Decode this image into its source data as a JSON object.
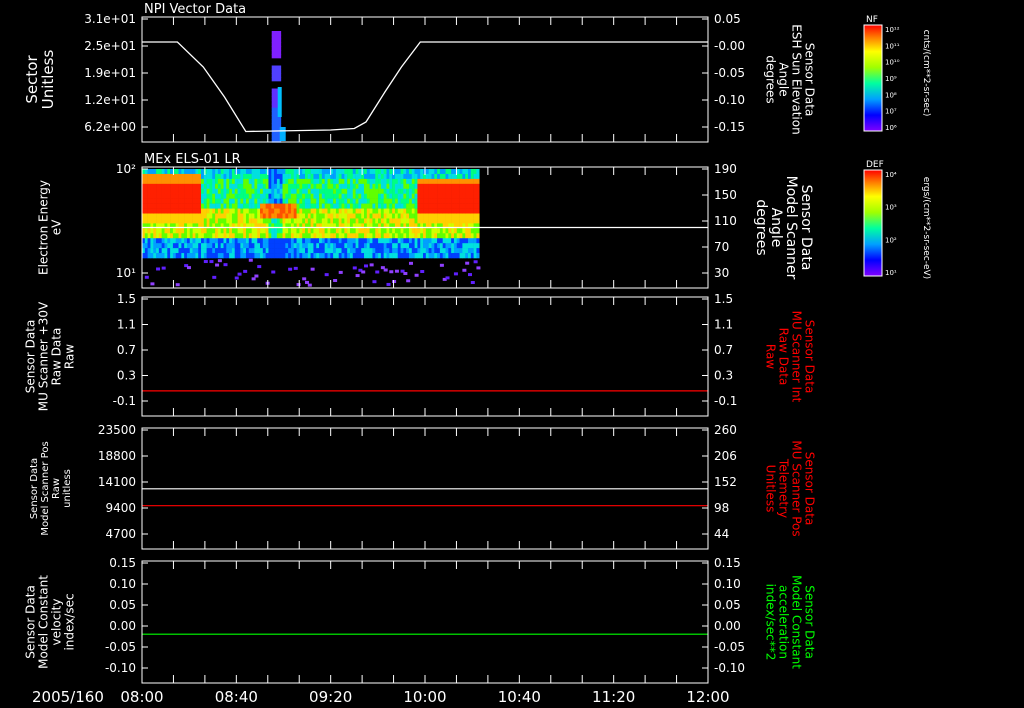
{
  "chart_data": {
    "date_label": "2005/160",
    "time_ticks": [
      "08:00",
      "08:40",
      "09:20",
      "10:00",
      "10:40",
      "11:20",
      "12:00"
    ],
    "time_range_min": [
      480,
      720
    ],
    "panels": [
      {
        "type": "heatmap",
        "title": "NPI Vector Data",
        "ylabel": [
          "Sector",
          "Unitless"
        ],
        "yticks": [
          "3.1e+01",
          "2.5e+01",
          "1.9e+01",
          "1.2e+01",
          "6.2e+00"
        ],
        "ylabel_right": [
          "Sensor Data",
          "ESH Sun Elevation",
          "Angle",
          "degrees"
        ],
        "yticks_right": [
          "0.05",
          "-0.00",
          "-0.05",
          "-0.10",
          "-0.15"
        ],
        "ylim_right": [
          -0.2,
          0.05
        ],
        "colorbar": {
          "label": "NF",
          "unit": "cnts/(cm**2-sr-sec)",
          "ticks": [
            "10¹²",
            "10¹¹",
            "10¹⁰",
            "10⁹",
            "10⁸",
            "10⁷",
            "10⁶"
          ]
        },
        "heatmap_block_min": [
          535,
          539
        ],
        "line_series": {
          "name": "ESH Sun Elevation Angle",
          "color": "#ffffff",
          "points": [
            [
              480,
              0.0
            ],
            [
              495,
              0.0
            ],
            [
              506,
              -0.05
            ],
            [
              515,
              -0.11
            ],
            [
              524,
              -0.179
            ],
            [
              560,
              -0.176
            ],
            [
              570,
              -0.173
            ],
            [
              575,
              -0.16
            ],
            [
              583,
              -0.1
            ],
            [
              590,
              -0.05
            ],
            [
              598,
              0.0
            ],
            [
              720,
              0.0
            ]
          ]
        }
      },
      {
        "type": "heatmap",
        "title": "MEx ELS-01 LR",
        "ylabel": [
          "Electron Energy",
          "eV"
        ],
        "yticks": [
          "10²",
          "10¹"
        ],
        "ylabel_right": [
          "Sensor Data",
          "Model Scanner",
          "Angle",
          "degrees"
        ],
        "yticks_right": [
          "190",
          "150",
          "110",
          "70",
          "30"
        ],
        "ylim_right": [
          10,
          190
        ],
        "colorbar": {
          "label": "DEF",
          "unit": "ergs/(cm**2-sr-sec-eV)",
          "ticks": [
            "10⁴",
            "10³",
            "10²",
            "10¹"
          ]
        },
        "data_end_min": 623,
        "line_series": {
          "name": "Model Scanner Angle",
          "color": "#ffffff",
          "points": [
            [
              480,
              100
            ],
            [
              720,
              100
            ]
          ]
        }
      },
      {
        "type": "line",
        "ylabel": [
          "Sensor Data",
          "MU Scanner +30V",
          "Raw Data",
          "Raw"
        ],
        "yticks": [
          "1.5",
          "1.1",
          "0.7",
          "0.3",
          "-0.1"
        ],
        "ylim": [
          -0.4,
          1.5
        ],
        "ylabel_right": [
          "Sensor Data",
          "MU Scanner Int",
          "Raw Data",
          "Raw"
        ],
        "yticks_right": [
          "1.5",
          "1.1",
          "0.7",
          "0.3",
          "-0.1"
        ],
        "right_label_color": "#ff0000",
        "series": [
          {
            "color": "#ff0000",
            "points": [
              [
                480,
                0.0
              ],
              [
                720,
                0.0
              ]
            ]
          }
        ]
      },
      {
        "type": "line",
        "ylabel": [
          "Sensor Data",
          "Model Scanner Pos",
          "Raw",
          "unitless"
        ],
        "yticks": [
          "23500",
          "18800",
          "14100",
          "9400",
          "4700"
        ],
        "ylim": [
          0,
          23500
        ],
        "ylabel_right": [
          "Sensor Data",
          "MU Scanner Pos",
          "Telemetry",
          "Unitless"
        ],
        "yticks_right": [
          "260",
          "206",
          "152",
          "98",
          "44"
        ],
        "right_label_color": "#ff0000",
        "series": [
          {
            "color": "#ffffff",
            "points": [
              [
                480,
                11700
              ],
              [
                720,
                11700
              ]
            ]
          },
          {
            "color": "#ff0000",
            "points": [
              [
                480,
                8400
              ],
              [
                720,
                8400
              ]
            ]
          }
        ]
      },
      {
        "type": "line",
        "ylabel": [
          "Sensor Data",
          "Model Constant",
          "velocity",
          "index/sec"
        ],
        "yticks": [
          "0.15",
          "0.10",
          "0.05",
          "0.00",
          "-0.05",
          "-0.10"
        ],
        "ylim": [
          -0.1,
          0.15
        ],
        "ylabel_right": [
          "Sensor Data",
          "Model Constant",
          "acceleration",
          "index/sec**2"
        ],
        "yticks_right": [
          "0.15",
          "0.10",
          "0.05",
          "0.00",
          "-0.05",
          "-0.10"
        ],
        "right_label_color": "#00ff00",
        "series": [
          {
            "color": "#00ff00",
            "points": [
              [
                480,
                0.0
              ],
              [
                720,
                0.0
              ]
            ]
          }
        ]
      }
    ]
  }
}
